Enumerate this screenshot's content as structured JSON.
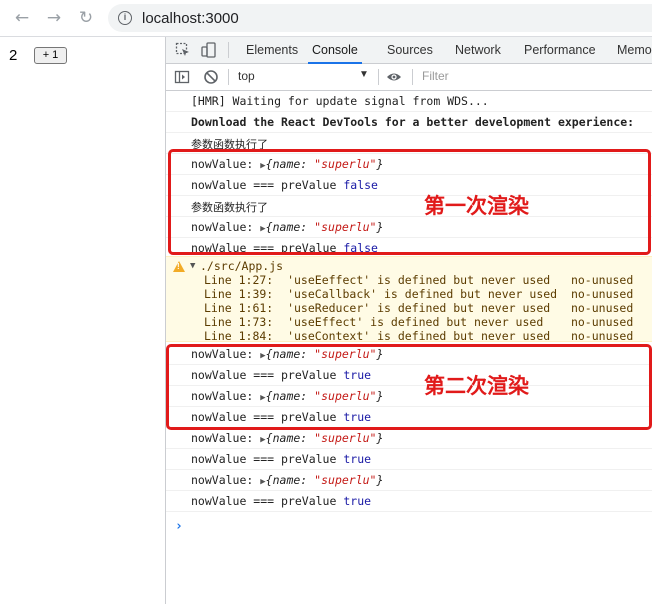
{
  "browser": {
    "url": "localhost:3000",
    "back_icon": "arrow-left-icon",
    "forward_icon": "arrow-right-icon",
    "reload_icon": "reload-icon"
  },
  "app": {
    "count": "2",
    "increment_label": "+ 1"
  },
  "devtools": {
    "tabs": [
      "Elements",
      "Console",
      "Sources",
      "Network",
      "Performance",
      "Memo"
    ],
    "active_tab": "Console",
    "context": "top",
    "filter_placeholder": "Filter"
  },
  "console": {
    "hmr": "[HMR] Waiting for update signal from WDS...",
    "devtools_msg": "Download the React DevTools for a better development experience:",
    "executed": "参数函数执行了",
    "now_value_label": "nowValue:",
    "object_key": "name:",
    "object_value": "\"superlu\"",
    "compare_label": "nowValue === preValue",
    "false_text": "false",
    "true_text": "true",
    "warning": {
      "file": "./src/App.js",
      "lines": [
        "Line 1:27:  'useEeffect' is defined but never used   no-unused",
        "Line 1:39:  'useCallback' is defined but never used  no-unused",
        "Line 1:61:  'useReducer' is defined but never used   no-unused",
        "Line 1:73:  'useEffect' is defined but never used    no-unused",
        "Line 1:84:  'useContext' is defined but never used   no-unused"
      ]
    },
    "prompt": "›"
  },
  "annotations": {
    "first_render": "第一次渲染",
    "second_render": "第二次渲染",
    "color": "#e11a1a"
  }
}
